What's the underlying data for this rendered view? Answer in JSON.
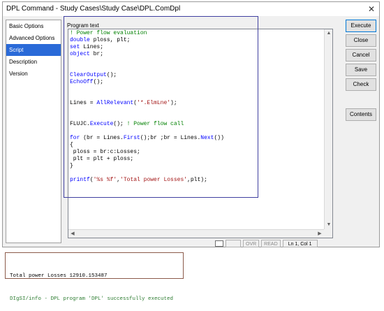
{
  "window": {
    "title": "DPL Command - Study Cases\\Study Case\\DPL.ComDpl",
    "close_glyph": "✕"
  },
  "sidebar": {
    "items": [
      {
        "label": "Basic Options"
      },
      {
        "label": "Advanced Options"
      },
      {
        "label": "Script"
      },
      {
        "label": "Description"
      },
      {
        "label": "Version"
      }
    ],
    "selected_index": 2
  },
  "editor": {
    "label": "Program text",
    "lines": [
      [
        {
          "t": "! Power flow evaluation",
          "c": "green"
        }
      ],
      [
        {
          "t": "double",
          "c": "blue"
        },
        {
          "t": " ploss, plt;",
          "c": "black"
        }
      ],
      [
        {
          "t": "set",
          "c": "blue"
        },
        {
          "t": " Lines;",
          "c": "black"
        }
      ],
      [
        {
          "t": "object",
          "c": "blue"
        },
        {
          "t": " br;",
          "c": "black"
        }
      ],
      [],
      [],
      [
        {
          "t": "ClearOutput",
          "c": "blue"
        },
        {
          "t": "();",
          "c": "black"
        }
      ],
      [
        {
          "t": "EchoOff",
          "c": "blue"
        },
        {
          "t": "();",
          "c": "black"
        }
      ],
      [],
      [],
      [
        {
          "t": "Lines = ",
          "c": "black"
        },
        {
          "t": "AllRelevant",
          "c": "blue"
        },
        {
          "t": "(",
          "c": "black"
        },
        {
          "t": "'*.ElmLne'",
          "c": "red"
        },
        {
          "t": ");",
          "c": "black"
        }
      ],
      [],
      [],
      [
        {
          "t": "FLUJC.",
          "c": "black"
        },
        {
          "t": "Execute",
          "c": "blue"
        },
        {
          "t": "(); ",
          "c": "black"
        },
        {
          "t": "! Power flow call",
          "c": "green"
        }
      ],
      [],
      [
        {
          "t": "for",
          "c": "blue"
        },
        {
          "t": " (br = Lines.",
          "c": "black"
        },
        {
          "t": "First",
          "c": "blue"
        },
        {
          "t": "();br ;br = Lines.",
          "c": "black"
        },
        {
          "t": "Next",
          "c": "blue"
        },
        {
          "t": "())",
          "c": "black"
        }
      ],
      [
        {
          "t": "{",
          "c": "black"
        }
      ],
      [
        {
          "t": " ploss = br:c:Losses;",
          "c": "black"
        }
      ],
      [
        {
          "t": " plt = plt + ploss;",
          "c": "black"
        }
      ],
      [
        {
          "t": "}",
          "c": "black"
        }
      ],
      [],
      [
        {
          "t": "printf",
          "c": "blue"
        },
        {
          "t": "(",
          "c": "black"
        },
        {
          "t": "'%s %f'",
          "c": "red"
        },
        {
          "t": ",",
          "c": "black"
        },
        {
          "t": "'Total power Losses'",
          "c": "red"
        },
        {
          "t": ",plt);",
          "c": "black"
        }
      ]
    ]
  },
  "status": {
    "ovr": "OVR",
    "read": "READ",
    "position": "Ln 1, Col 1"
  },
  "buttons": {
    "execute": "Execute",
    "close": "Close",
    "cancel": "Cancel",
    "save": "Save",
    "check": "Check",
    "contents": "Contents"
  },
  "output": {
    "line1": "Total power Losses 12910.153487",
    "line2": "DIgSI/info - DPL program 'DPL' successfully executed"
  },
  "colors": {
    "green": "#008000",
    "blue": "#0000ff",
    "red": "#a31515",
    "black": "#000000",
    "selection": "#2a6ad8"
  }
}
